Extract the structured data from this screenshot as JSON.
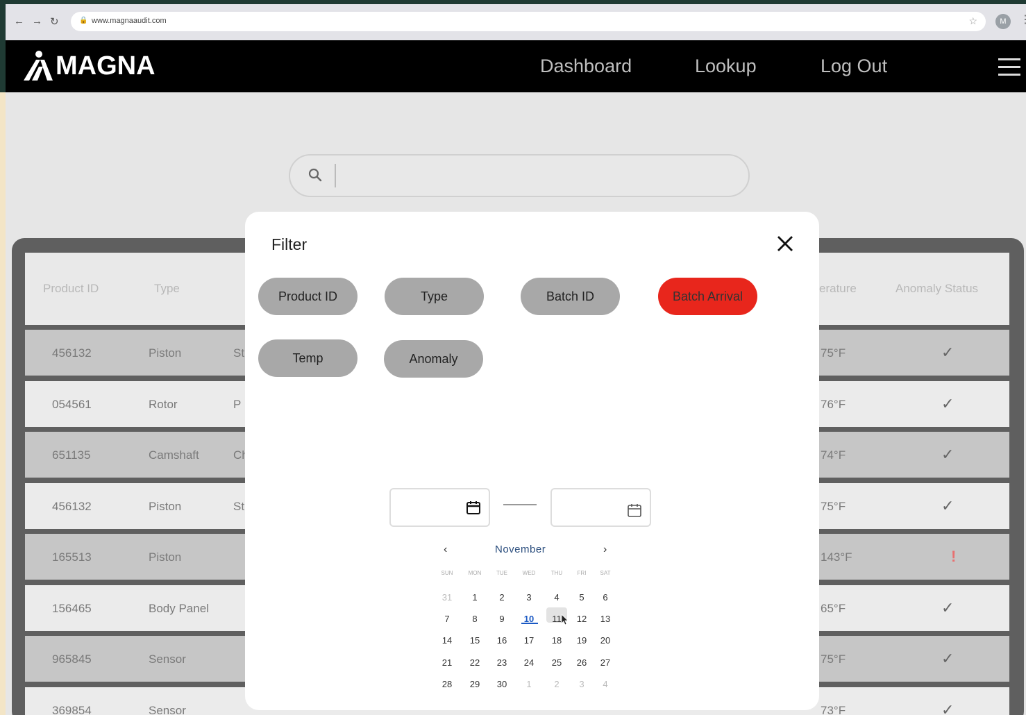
{
  "browser": {
    "url": "www.magnaaudit.com",
    "profile_initial": "M",
    "back": "←",
    "forward": "→",
    "reload": "↻"
  },
  "header": {
    "logo_text": "MAGNA",
    "nav": [
      "Dashboard",
      "Lookup",
      "Log Out"
    ]
  },
  "search": {
    "placeholder": ""
  },
  "table": {
    "columns": [
      "Product ID",
      "Type",
      "erature",
      "Anomaly Status"
    ],
    "rows": [
      {
        "id": "456132",
        "type": "Piston",
        "c2": "St",
        "temp": "75°F",
        "status": "check"
      },
      {
        "id": "054561",
        "type": "Rotor",
        "c2": "P",
        "temp": "76°F",
        "status": "check"
      },
      {
        "id": "651135",
        "type": "Camshaft",
        "c2": "Chev",
        "temp": "74°F",
        "status": "check"
      },
      {
        "id": "456132",
        "type": "Piston",
        "c2": "St",
        "temp": "75°F",
        "status": "check"
      },
      {
        "id": "165513",
        "type": "Piston",
        "c2": "",
        "temp": "143°F",
        "status": "alert"
      },
      {
        "id": "156465",
        "type": "Body Panel",
        "c2": "",
        "temp": "65°F",
        "status": "check"
      },
      {
        "id": "965845",
        "type": "Sensor",
        "c2": "",
        "temp": "75°F",
        "status": "check"
      },
      {
        "id": "369854",
        "type": "Sensor",
        "c2": "",
        "temp": "73°F",
        "status": "check"
      }
    ],
    "check_glyph": "✓",
    "alert_glyph": "!"
  },
  "filter": {
    "title": "Filter",
    "chips": [
      {
        "label": "Product ID",
        "active": false
      },
      {
        "label": "Type",
        "active": false
      },
      {
        "label": "Batch ID",
        "active": false
      },
      {
        "label": "Batch Arrival",
        "active": true
      },
      {
        "label": "Temp",
        "active": false
      },
      {
        "label": "Anomaly",
        "active": false
      }
    ],
    "start_date": "",
    "end_date": ""
  },
  "calendar": {
    "month": "November",
    "prev": "‹",
    "next": "›",
    "weekdays": [
      "SUN",
      "MON",
      "TUE",
      "WED",
      "THU",
      "FRI",
      "SAT"
    ],
    "weeks": [
      [
        "31",
        "1",
        "2",
        "3",
        "4",
        "5",
        "6"
      ],
      [
        "7",
        "8",
        "9",
        "10",
        "11",
        "12",
        "13"
      ],
      [
        "14",
        "15",
        "16",
        "17",
        "18",
        "19",
        "20"
      ],
      [
        "21",
        "22",
        "23",
        "24",
        "25",
        "26",
        "27"
      ],
      [
        "28",
        "29",
        "30",
        "1",
        "2",
        "3",
        "4"
      ]
    ],
    "today": "10",
    "hovered": "11"
  },
  "colors": {
    "accent_red": "#e8261c",
    "chip_gray": "#a8a8a8",
    "calendar_blue": "#1a59c4"
  }
}
